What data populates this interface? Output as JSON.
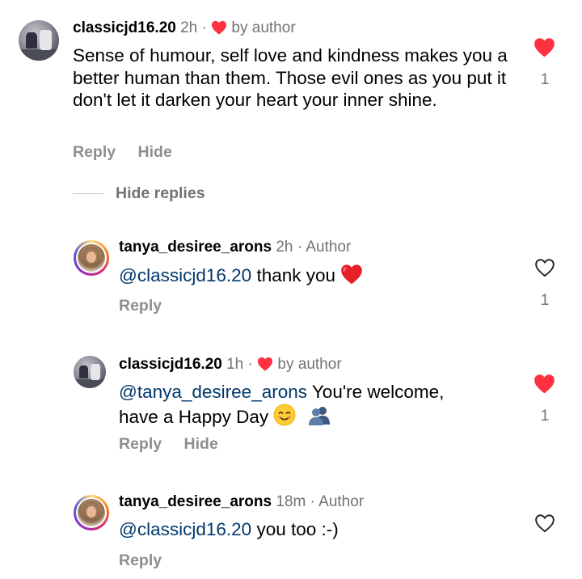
{
  "comments": [
    {
      "username": "classicjd16.20",
      "time": "2h",
      "separator": "·",
      "author_tag": "by author",
      "text": "Sense of humour, self love and kindness makes you a better human than them.  Those evil ones as you put it don't let it darken your heart your inner shine.",
      "actions": [
        "Reply",
        "Hide"
      ],
      "liked": true,
      "like_count": "1"
    },
    {
      "username": "tanya_desiree_arons",
      "time": "2h",
      "separator": "·",
      "author_tag": "Author",
      "mention": "@classicjd16.20",
      "text": "thank you",
      "emoji": "red-heart",
      "actions": [
        "Reply"
      ],
      "liked": false,
      "like_count": "1"
    },
    {
      "username": "classicjd16.20",
      "time": "1h",
      "separator": "·",
      "author_tag": "by author",
      "mention": "@tanya_desiree_arons",
      "text_line1": "You're welcome,",
      "text_line2": "have a Happy Day",
      "emojis": [
        "smiling-face-with-smiling-eyes",
        "busts-in-silhouette"
      ],
      "actions": [
        "Reply",
        "Hide"
      ],
      "liked": true,
      "like_count": "1"
    },
    {
      "username": "tanya_desiree_arons",
      "time": "18m",
      "separator": "·",
      "author_tag": "Author",
      "mention": "@classicjd16.20",
      "text": "you too :-)",
      "actions": [
        "Reply"
      ],
      "liked": false,
      "like_count": ""
    }
  ],
  "thread": {
    "hide_replies_label": "Hide replies"
  },
  "colors": {
    "like_red": "#ff3040",
    "meta_gray": "#737373",
    "action_gray": "#8e8e8e",
    "mention_blue": "#00376b"
  }
}
